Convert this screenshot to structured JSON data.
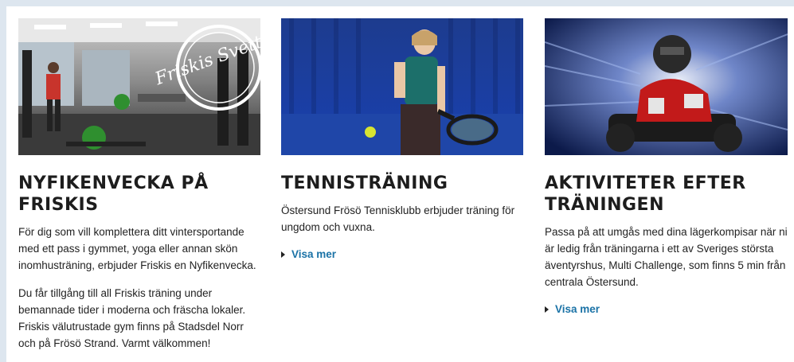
{
  "cards": [
    {
      "title": "NYFIKENVECKA PÅ FRISKIS",
      "paragraphs": [
        "För dig som vill komplettera ditt vintersportande med ett pass i gymmet, yoga eller annan skön inomhusträning, erbjuder Friskis en Nyfikenvecka.",
        "Du får tillgång till all Friskis träning under bemannade tider i moderna och fräscha lokaler. Friskis välutrustade gym finns på Stadsdel Norr och på Frösö Strand. Varmt välkommen!"
      ],
      "image_logo_text": "Friskis Svettis",
      "image": "gym-photo"
    },
    {
      "title": "TENNISTRÄNING",
      "paragraphs": [
        "Östersund Frösö Tennisklubb erbjuder träning för ungdom och vuxna."
      ],
      "link": "Visa mer",
      "image": "tennis-photo"
    },
    {
      "title": "AKTIVITETER EFTER TRÄNINGEN",
      "paragraphs": [
        "Passa på att umgås med dina lägerkompisar när ni är ledig från träningarna i ett av Sveriges största äventyrshus, Multi Challenge, som finns 5 min från centrala Östersund."
      ],
      "link": "Visa mer",
      "image": "gokart-photo"
    }
  ],
  "colors": {
    "link": "#1a72a6",
    "title": "#1d1d1d",
    "page_bg": "#dde6ef"
  }
}
